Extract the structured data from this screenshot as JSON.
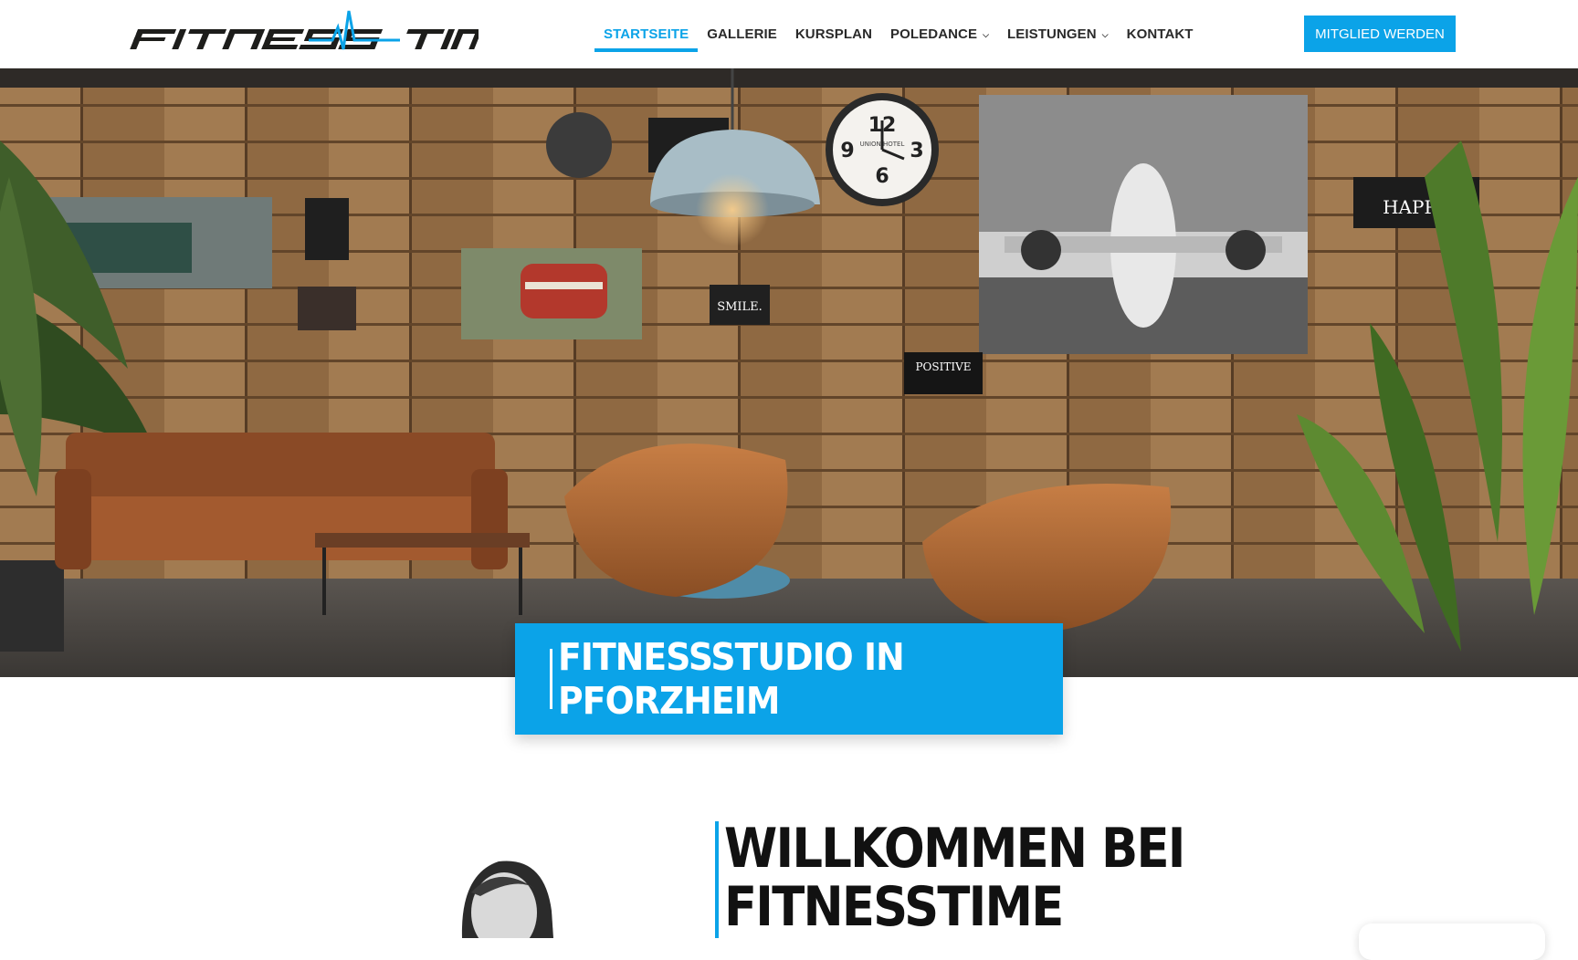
{
  "header": {
    "logo_text": "FITNESS TIME",
    "nav": [
      {
        "label": "STARTSEITE",
        "active": true,
        "dropdown": false
      },
      {
        "label": "GALLERIE",
        "active": false,
        "dropdown": false
      },
      {
        "label": "KURSPLAN",
        "active": false,
        "dropdown": false
      },
      {
        "label": "POLEDANCE",
        "active": false,
        "dropdown": true
      },
      {
        "label": "LEISTUNGEN",
        "active": false,
        "dropdown": true
      },
      {
        "label": "KONTAKT",
        "active": false,
        "dropdown": false
      }
    ],
    "cta_label": "MITGLIED WERDEN"
  },
  "hero": {
    "title": "FITNESSSTUDIO IN PFORZHEIM",
    "signs": {
      "happy": "HAPPY.",
      "smile": "SMILE.",
      "positive": "POSITIVE",
      "hotel": "UNION HOTEL"
    }
  },
  "welcome": {
    "heading_line1": "WILLKOMMEN BEI",
    "heading_line2": "FITNESSTIME"
  },
  "colors": {
    "accent": "#0ba3e8",
    "text_dark": "#2a2a2a"
  },
  "icons": [
    "chevron-down-icon",
    "logo-heartbeat-icon"
  ]
}
